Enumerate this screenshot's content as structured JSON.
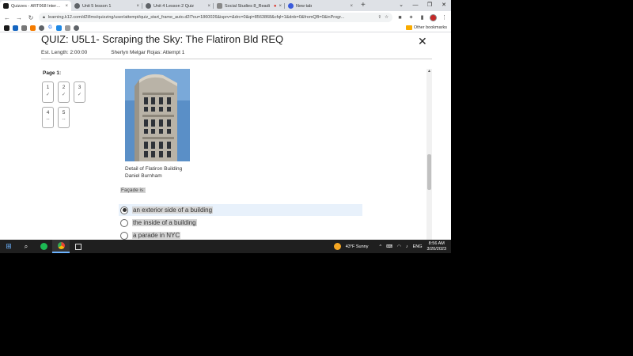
{
  "browser": {
    "tabs": [
      {
        "label": "Quizzes - ART068 Intermediate",
        "active": true,
        "favicon_color": "#1a1a1a"
      },
      {
        "label": "Unit 5 lesson 1",
        "active": false,
        "favicon_color": "#5f6368"
      },
      {
        "label": "Unit 4 Lesson 2 Quiz",
        "active": false,
        "favicon_color": "#5f6368"
      },
      {
        "label": "Social Studies 8_Readi",
        "active": false,
        "favicon_color": "#888888"
      },
      {
        "label": "New tab",
        "active": false,
        "favicon_color": "#3b5bdb"
      }
    ],
    "new_tab_glyph": "+",
    "url": "learning.k12.com/d2l/lms/quizzing/user/attempt/quiz_start_frame_auto.d2l?ou=1860026&isprv=&drc=0&qi=8563868&cfql=1&dnb=0&fromQB=0&inProgr...",
    "bookmarks_other": "Other bookmarks"
  },
  "quiz": {
    "title": "QUIZ: U5L1- Scraping the Sky: The Flatiron Bld REQ",
    "est_length": "Est. Length: 2:00:00",
    "attempt": "Sherlyn Melgar Rojas: Attempt 1",
    "page_label": "Page 1:",
    "questions": [
      {
        "num": "1",
        "status": "✓"
      },
      {
        "num": "2",
        "status": "✓"
      },
      {
        "num": "3",
        "status": "✓"
      },
      {
        "num": "4",
        "status": "--"
      },
      {
        "num": "5",
        "status": "--"
      }
    ],
    "caption_line1": "Detail of Flatiron Building",
    "caption_line2": "Daniel Burnham",
    "prompt": "Façade is:",
    "options": [
      {
        "label": "an exterior side of a building",
        "selected": true
      },
      {
        "label": "the inside of a building",
        "selected": false
      },
      {
        "label": "a parade in NYC",
        "selected": false
      }
    ]
  },
  "taskbar": {
    "weather": "43°F  Sunny",
    "lang": "ENG",
    "time": "8:56 AM",
    "date": "3/20/2023"
  }
}
